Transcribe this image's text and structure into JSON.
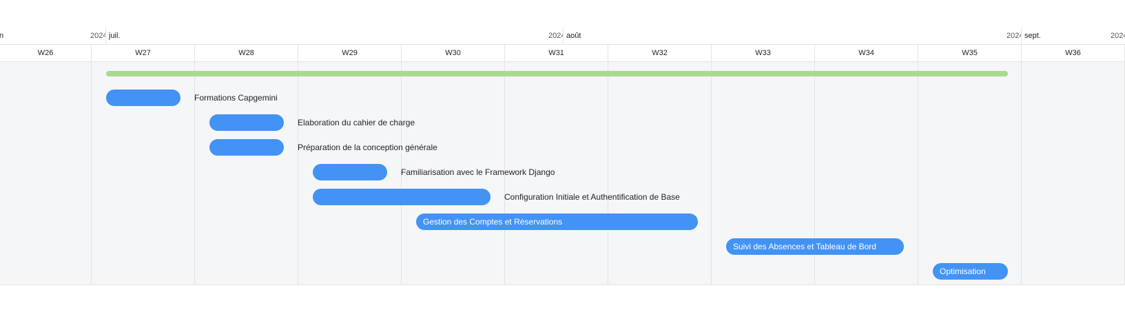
{
  "months": [
    {
      "name": "n",
      "year": "2024"
    },
    {
      "name": "juil.",
      "year": "2024"
    },
    {
      "name": "août",
      "year": "2024"
    },
    {
      "name": "sept.",
      "year": "2024"
    }
  ],
  "weeks": [
    "W26",
    "W27",
    "W28",
    "W29",
    "W30",
    "W31",
    "W32",
    "W33",
    "W34",
    "W35",
    "W36"
  ],
  "tasks": [
    {
      "name": "Formations Capgemini",
      "label_position": "outside"
    },
    {
      "name": "Elaboration du cahier de charge",
      "label_position": "outside"
    },
    {
      "name": "Préparation de la conception générale",
      "label_position": "outside"
    },
    {
      "name": "Familiarisation avec le Framework Django",
      "label_position": "outside"
    },
    {
      "name": "Configuration Initiale et Authentification de Base",
      "label_position": "outside"
    },
    {
      "name": "Gestion des Comptes et Réservations",
      "label_position": "inside"
    },
    {
      "name": "Suivi des Absences et Tableau de Bord",
      "label_position": "inside"
    },
    {
      "name": "Optimisation",
      "label_position": "inside"
    }
  ],
  "colors": {
    "task": "#4293f4",
    "summary": "#a8d98f",
    "grid_bg": "#f5f6f8",
    "grid_line": "#e3e3e3"
  }
}
